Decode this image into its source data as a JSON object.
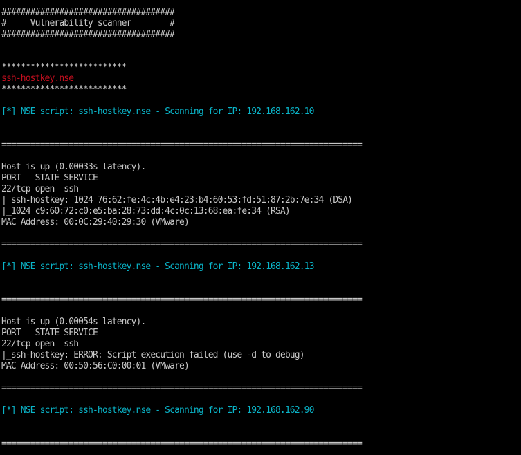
{
  "window": {
    "background": "#000000"
  },
  "colors": {
    "default": "#c7c7c7",
    "red": "#c50f1f",
    "cyan": "#0ab4c8"
  },
  "terminal": {
    "lines": [
      {
        "text": "####################################",
        "color": "default"
      },
      {
        "text": "#     Vulnerability scanner        #",
        "color": "default"
      },
      {
        "text": "####################################",
        "color": "default"
      },
      {
        "text": "",
        "color": "default"
      },
      {
        "text": "",
        "color": "default"
      },
      {
        "text": "**************************",
        "color": "default"
      },
      {
        "text": "ssh-hostkey.nse",
        "color": "red"
      },
      {
        "text": "**************************",
        "color": "default"
      },
      {
        "text": "",
        "color": "default"
      },
      {
        "text": "[*] NSE script: ssh-hostkey.nse - Scanning for IP: 192.168.162.10",
        "color": "cyan"
      },
      {
        "text": "",
        "color": "default"
      },
      {
        "text": "",
        "color": "default"
      },
      {
        "text": "===========================================================================",
        "color": "default"
      },
      {
        "text": "",
        "color": "default"
      },
      {
        "text": "Host is up (0.00033s latency).",
        "color": "default"
      },
      {
        "text": "PORT   STATE SERVICE",
        "color": "default"
      },
      {
        "text": "22/tcp open  ssh",
        "color": "default"
      },
      {
        "text": "| ssh-hostkey: 1024 76:62:fe:4c:4b:e4:23:b4:60:53:fd:51:87:2b:7e:34 (DSA)",
        "color": "default"
      },
      {
        "text": "|_1024 c9:60:72:c0:e5:ba:28:73:dd:4c:0c:13:68:ea:fe:34 (RSA)",
        "color": "default"
      },
      {
        "text": "MAC Address: 00:0C:29:40:29:30 (VMware)",
        "color": "default"
      },
      {
        "text": "",
        "color": "default"
      },
      {
        "text": "===========================================================================",
        "color": "default"
      },
      {
        "text": "",
        "color": "default"
      },
      {
        "text": "[*] NSE script: ssh-hostkey.nse - Scanning for IP: 192.168.162.13",
        "color": "cyan"
      },
      {
        "text": "",
        "color": "default"
      },
      {
        "text": "",
        "color": "default"
      },
      {
        "text": "===========================================================================",
        "color": "default"
      },
      {
        "text": "",
        "color": "default"
      },
      {
        "text": "Host is up (0.00054s latency).",
        "color": "default"
      },
      {
        "text": "PORT   STATE SERVICE",
        "color": "default"
      },
      {
        "text": "22/tcp open  ssh",
        "color": "default"
      },
      {
        "text": "|_ssh-hostkey: ERROR: Script execution failed (use -d to debug)",
        "color": "default"
      },
      {
        "text": "MAC Address: 00:50:56:C0:00:01 (VMware)",
        "color": "default"
      },
      {
        "text": "",
        "color": "default"
      },
      {
        "text": "===========================================================================",
        "color": "default"
      },
      {
        "text": "",
        "color": "default"
      },
      {
        "text": "[*] NSE script: ssh-hostkey.nse - Scanning for IP: 192.168.162.90",
        "color": "cyan"
      },
      {
        "text": "",
        "color": "default"
      },
      {
        "text": "",
        "color": "default"
      },
      {
        "text": "===========================================================================",
        "color": "default"
      }
    ]
  }
}
